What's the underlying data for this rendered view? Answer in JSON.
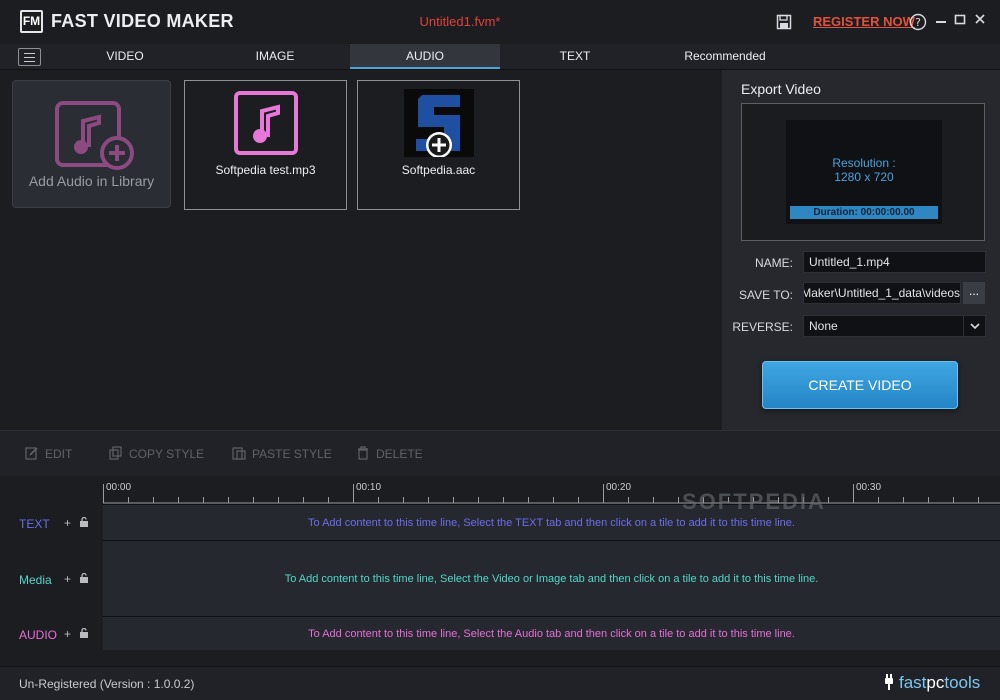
{
  "app": {
    "logo_text": "FM",
    "name": "FAST VIDEO MAKER",
    "document_title": "Untitled1.fvm*",
    "register_label": "REGISTER NOW"
  },
  "colors": {
    "accent": "#4aa3dc",
    "register": "#e3523a",
    "text_track": "#6b6ee8",
    "media_track": "#55d6c9",
    "audio_track": "#e66fd8"
  },
  "tabs": [
    {
      "label": "VIDEO",
      "active": false
    },
    {
      "label": "IMAGE",
      "active": false
    },
    {
      "label": "AUDIO",
      "active": true
    },
    {
      "label": "TEXT",
      "active": false
    },
    {
      "label": "Recommended",
      "active": false
    }
  ],
  "library": {
    "add_label": "Add Audio in Library",
    "items": [
      {
        "name": "Softpedia test.mp3",
        "icon": "music-note-icon"
      },
      {
        "name": "Softpedia.aac",
        "icon": "softpedia-thumbnail"
      }
    ]
  },
  "export": {
    "title": "Export Video",
    "resolution_label": "Resolution :",
    "resolution_value": "1280 x 720",
    "duration": "Duration: 00:00:00.00",
    "name_label": "NAME:",
    "name_value": "Untitled_1.mp4",
    "save_label": "SAVE TO:",
    "save_value": "Maker\\Untitled_1_data\\videos",
    "browse_label": "...",
    "reverse_label": "REVERSE:",
    "reverse_value": "None",
    "create_label": "CREATE VIDEO"
  },
  "toolbar": {
    "edit": "EDIT",
    "copy_style": "COPY STYLE",
    "paste_style": "PASTE STYLE",
    "delete": "DELETE"
  },
  "timeline": {
    "ruler": [
      "00:00",
      "00:10",
      "00:20",
      "00:30"
    ],
    "watermark": "SOFTPEDIA",
    "tracks": [
      {
        "name": "TEXT",
        "hint": "To Add content to this time line, Select the TEXT tab and then click on a tile to add it to this time line."
      },
      {
        "name": "Media",
        "hint": "To Add content to this time line, Select the Video or Image tab and then click on a tile to add it to this time line."
      },
      {
        "name": "AUDIO",
        "hint": "To Add content to this time line, Select the Audio tab and then click on a tile to add it to this time line."
      }
    ]
  },
  "status": {
    "text": "Un-Registered (Version : 1.0.0.2)",
    "brand_fast": "fast",
    "brand_pc": "pc",
    "brand_tools": "tools"
  }
}
